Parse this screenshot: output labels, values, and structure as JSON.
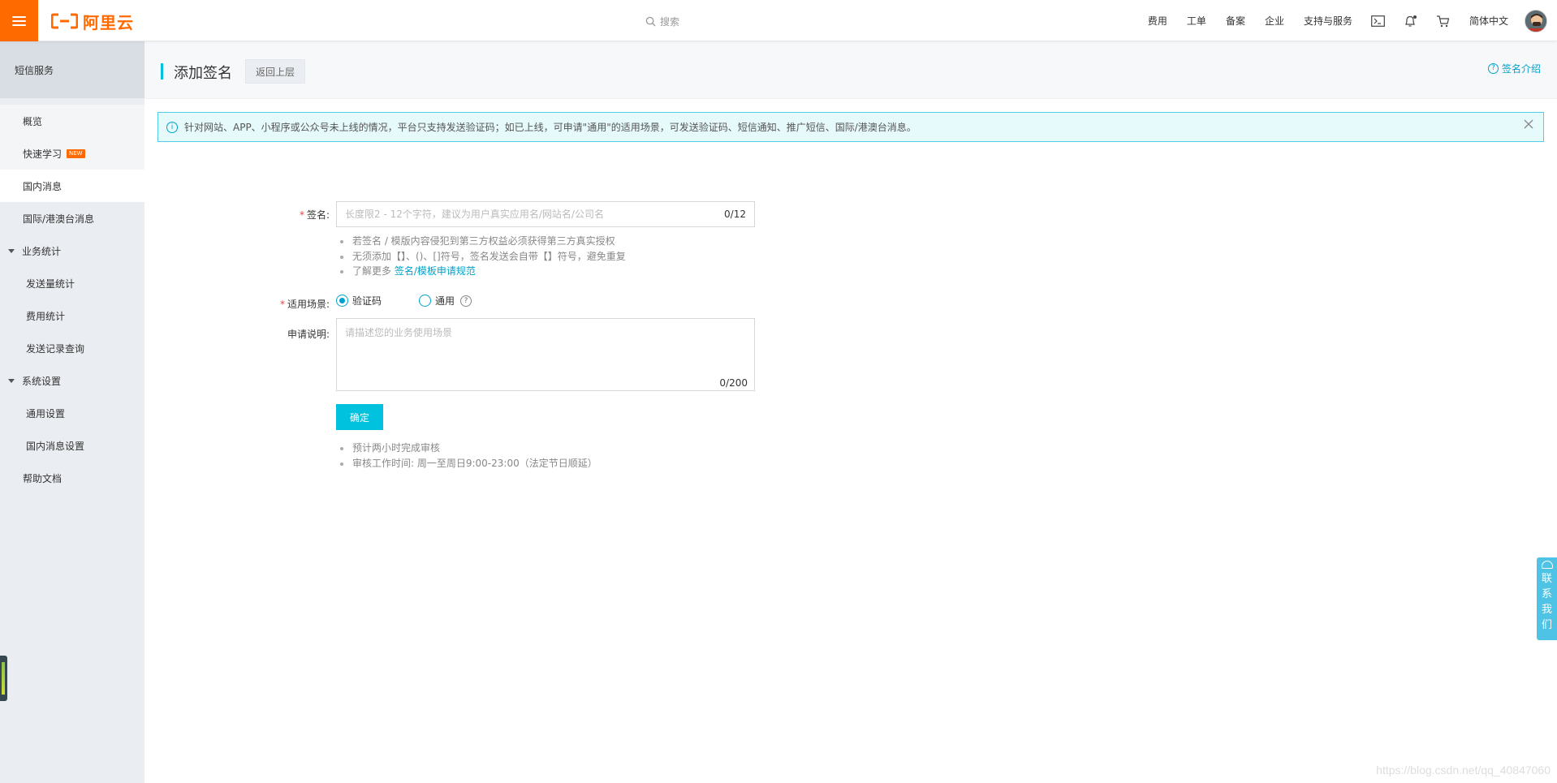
{
  "topbar": {
    "logo_text": "阿里云",
    "search_placeholder": "搜索",
    "nav": [
      "费用",
      "工单",
      "备案",
      "企业",
      "支持与服务"
    ],
    "language": "简体中文",
    "icons": [
      "terminal-icon",
      "bell-icon",
      "cart-icon"
    ]
  },
  "sidebar": {
    "title": "短信服务",
    "items": {
      "overview": "概览",
      "quick_learn": "快速学习",
      "new_badge": "NEW",
      "domestic": "国内消息",
      "international": "国际/港澳台消息",
      "stats_group": "业务统计",
      "send_stats": "发送量统计",
      "fee_stats": "费用统计",
      "send_records": "发送记录查询",
      "settings_group": "系统设置",
      "general_settings": "通用设置",
      "domestic_settings": "国内消息设置",
      "help": "帮助文档"
    }
  },
  "page": {
    "title": "添加签名",
    "back": "返回上层",
    "intro_link": "签名介绍",
    "notice": "针对网站、APP、小程序或公众号未上线的情况，平台只支持发送验证码；如已上线，可申请\"通用\"的适用场景，可发送验证码、短信通知、推广短信、国际/港澳台消息。"
  },
  "form": {
    "signature": {
      "label": "签名:",
      "placeholder": "长度限2 - 12个字符，建议为用户真实应用名/网站名/公司名",
      "value": "",
      "counter": "0/12",
      "tips": [
        "若签名 / 模版内容侵犯到第三方权益必须获得第三方真实授权",
        "无须添加【】、()、[]符号，签名发送会自带【】符号，避免重复"
      ],
      "tip_more_prefix": "了解更多",
      "tip_more_link": "签名/模板申请规范"
    },
    "scenario": {
      "label": "适用场景:",
      "options": [
        "验证码",
        "通用"
      ],
      "selected": "验证码"
    },
    "description": {
      "label": "申请说明:",
      "placeholder": "请描述您的业务使用场景",
      "value": "",
      "counter": "0/200"
    },
    "confirm": "确定",
    "footer_tips": [
      "预计两小时完成审核",
      "审核工作时间: 周一至周日9:00-23:00（法定节日顺延）"
    ]
  },
  "contact": [
    "联",
    "系",
    "我",
    "们"
  ],
  "watermark": "https://blog.csdn.net/qq_40847060",
  "colors": {
    "brand": "#ff6a00",
    "primary": "#00c1de",
    "link": "#00a2ca",
    "required": "#e04747"
  }
}
